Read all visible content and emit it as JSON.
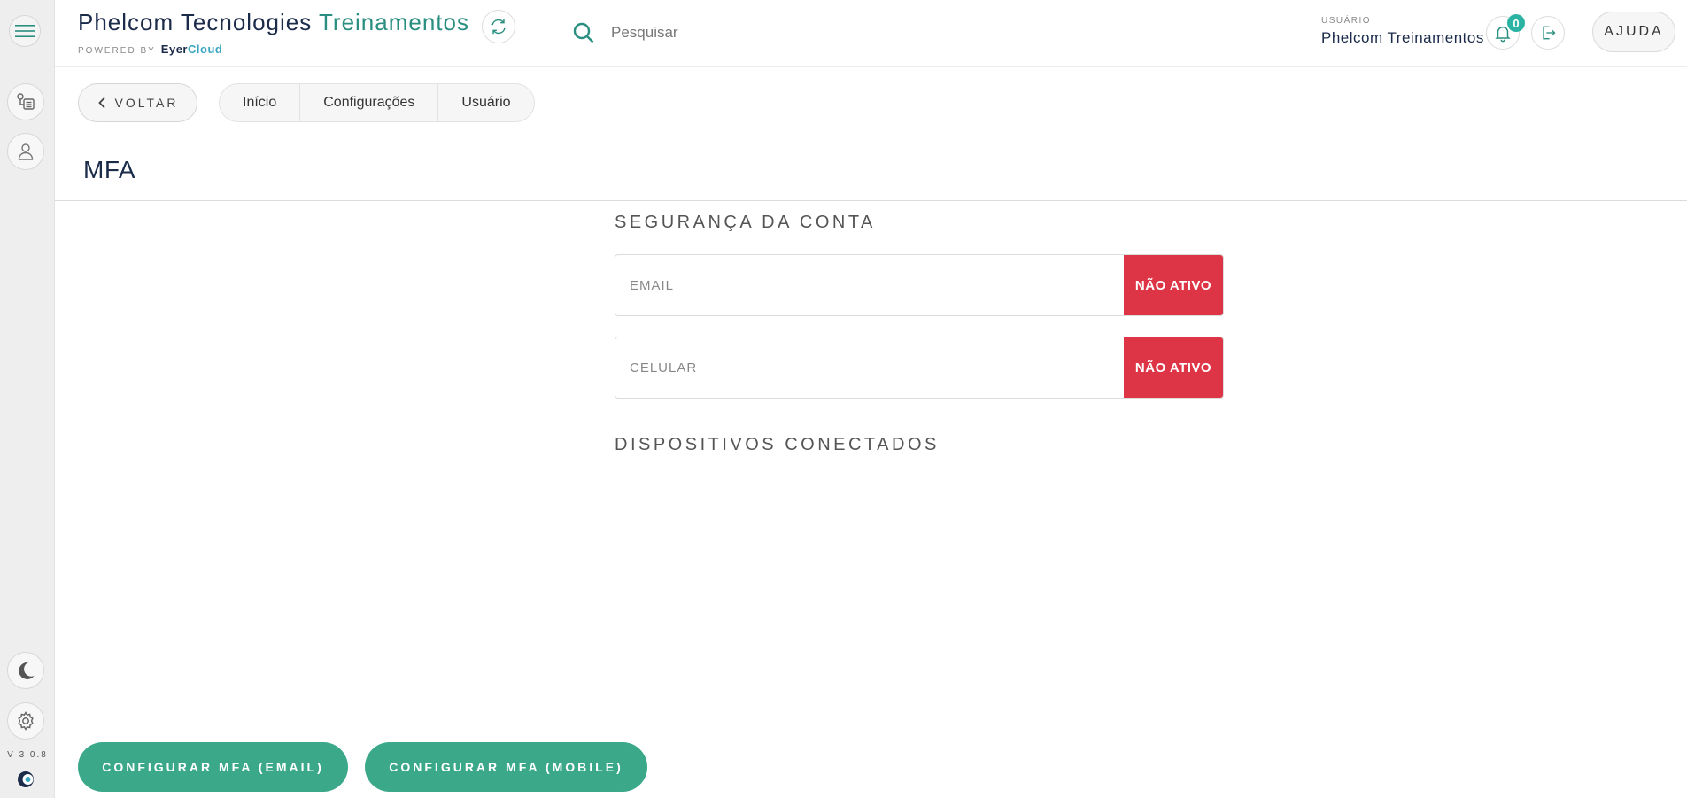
{
  "app": {
    "title_main": "Phelcom Tecnologies",
    "title_accent": "Treinamentos",
    "powered_by": "POWERED BY",
    "brand_eyer": "Eyer",
    "brand_cloud": "Cloud",
    "version": "V 3.0.8"
  },
  "search": {
    "placeholder": "Pesquisar"
  },
  "user": {
    "label": "USUÁRIO",
    "name": "Phelcom Treinamentos",
    "notifications": "0"
  },
  "header": {
    "help_label": "AJUDA"
  },
  "nav": {
    "back_label": "VOLTAR",
    "breadcrumb": [
      {
        "label": "Início"
      },
      {
        "label": "Configurações"
      },
      {
        "label": "Usuário"
      }
    ]
  },
  "page": {
    "title": "MFA"
  },
  "security": {
    "title": "SEGURANÇA DA CONTA",
    "methods": [
      {
        "label": "EMAIL",
        "status": "NÃO ATIVO"
      },
      {
        "label": "CELULAR",
        "status": "NÃO ATIVO"
      }
    ]
  },
  "devices": {
    "title": "DISPOSITIVOS CONECTADOS"
  },
  "footer": {
    "config_email": "CONFIGURAR MFA (EMAIL)",
    "config_mobile": "CONFIGURAR MFA (MOBILE)"
  },
  "colors": {
    "accent": "#3aa889",
    "danger": "#dd3546",
    "navy": "#1b2b4a"
  }
}
